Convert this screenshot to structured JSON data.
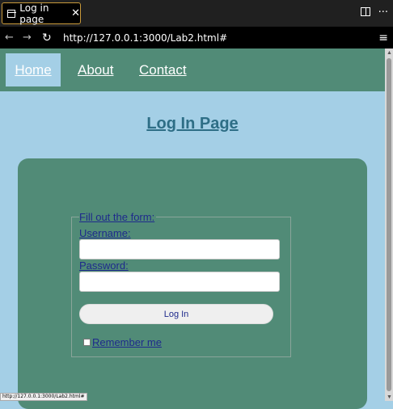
{
  "browser": {
    "tab_title": "Log in page",
    "tab_close": "✕",
    "split_label": "",
    "more_label": "···",
    "back": "←",
    "forward": "→",
    "reload": "↻",
    "url": "http://127.0.0.1:3000/Lab2.html#",
    "menu": "≡",
    "status_url": "http://127.0.0.1:3000/Lab2.html#"
  },
  "nav": {
    "home": "Home",
    "about": "About",
    "contact": "Contact"
  },
  "page": {
    "title": "Log In Page"
  },
  "form": {
    "legend": "Fill out the form:",
    "username_label": "Username:",
    "username_value": "",
    "password_label": "Password:",
    "password_value": "",
    "login_button": "Log In",
    "remember_label": " Remember me",
    "remember_checked": false
  },
  "colors": {
    "page_bg": "#a4cfe6",
    "nav_bg": "#518b77",
    "card_bg": "#518b77",
    "title_color": "#2e6e86",
    "label_color": "#1e2a8c"
  }
}
